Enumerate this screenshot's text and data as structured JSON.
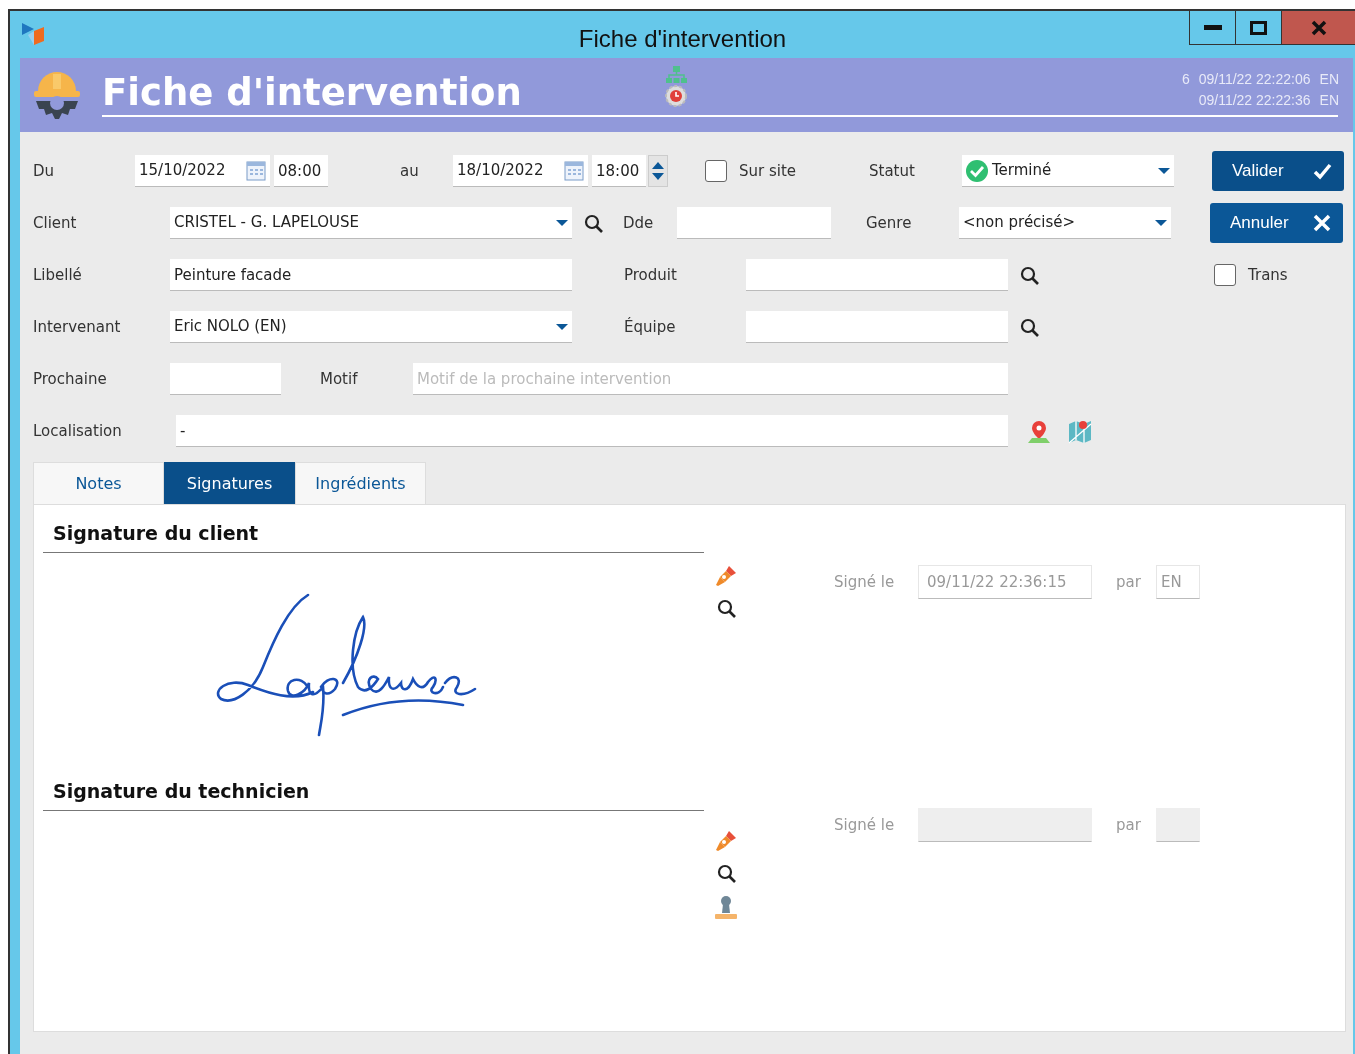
{
  "window": {
    "title": "Fiche d'intervention"
  },
  "header": {
    "title": "Fiche d'intervention",
    "info_lines": [
      [
        "6",
        "09/11/22 22:22:06",
        "EN"
      ],
      [
        "09/11/22 22:22:36",
        "EN"
      ]
    ]
  },
  "form": {
    "du": {
      "label": "Du",
      "date": "15/10/2022",
      "time": "08:00"
    },
    "au": {
      "label": "au",
      "date": "18/10/2022",
      "time": "18:00"
    },
    "sur_site": {
      "label": "Sur site",
      "checked": false
    },
    "statut": {
      "label": "Statut",
      "value": "Terminé"
    },
    "client": {
      "label": "Client",
      "value": "CRISTEL - G. LAPELOUSE"
    },
    "dde": {
      "label": "Dde"
    },
    "genre": {
      "label": "Genre",
      "value": "<non précisé>"
    },
    "libelle": {
      "label": "Libellé",
      "value": "Peinture facade"
    },
    "produit": {
      "label": "Produit"
    },
    "trans": {
      "label": "Trans",
      "checked": false
    },
    "intervenant": {
      "label": "Intervenant",
      "value": "Eric NOLO (EN)"
    },
    "equipe": {
      "label": "Équipe"
    },
    "prochaine": {
      "label": "Prochaine"
    },
    "motif": {
      "label": "Motif",
      "placeholder": "Motif de la prochaine intervention"
    },
    "localisation": {
      "label": "Localisation",
      "value": "-"
    }
  },
  "buttons": [
    {
      "label": "Valider",
      "kind": "validate"
    },
    {
      "label": "Annuler",
      "kind": "cancel"
    }
  ],
  "tabs": [
    {
      "label": "Notes",
      "selected": false
    },
    {
      "label": "Signatures",
      "selected": true
    },
    {
      "label": "Ingrédients",
      "selected": false
    }
  ],
  "signatures": [
    {
      "title": "Signature du client",
      "signed": true,
      "stamp_tool": false,
      "signed_label": "Signé le",
      "date": "09/11/22 22:36:15",
      "by_label": "par",
      "by": "EN"
    },
    {
      "title": "Signature du technicien",
      "signed": false,
      "stamp_tool": true,
      "signed_label": "Signé le",
      "by_label": "par"
    }
  ]
}
